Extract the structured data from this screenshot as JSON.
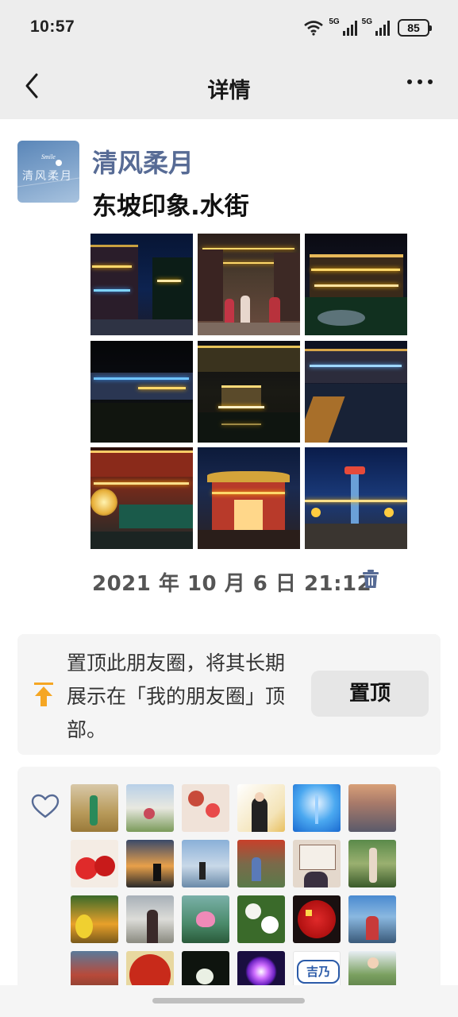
{
  "status_bar": {
    "time": "10:57",
    "network1": "5G",
    "network2": "5G",
    "battery": "85"
  },
  "nav": {
    "title": "详情"
  },
  "post": {
    "username": "清风柔月",
    "avatar_text": "清风柔月",
    "avatar_logo": "Smile",
    "text": "东坡印象.水街",
    "date": "2021 年 10 月 6 日 21:12",
    "photo_count": 9,
    "photo_icons": [
      "night-street-photo",
      "night-crowd-lanterns-photo",
      "night-pavilion-photo",
      "night-riverside-buildings-photo",
      "night-pavilion-reflection-photo",
      "night-bridge-water-photo",
      "night-lantern-gate-photo",
      "night-archway-photo",
      "night-tower-plaza-photo"
    ]
  },
  "pin_card": {
    "text": "置顶此朋友圈，将其长期展示在「我的朋友圈」顶部。",
    "button_label": "置顶"
  },
  "likes": {
    "liker_avatars": [
      "autumn-woman",
      "lake-woman",
      "cartoon-girl-chen",
      "graduation-woman",
      "blue-sky-tower",
      "sunset-sea",
      "red-cherries",
      "sunset-silhouette",
      "beach-woman",
      "garden-woman",
      "calligraphy-man",
      "flowers-woman",
      "yellow-fruit",
      "woman-temple",
      "pink-lotus",
      "white-flowers",
      "red-flag-coin",
      "seaside-woman",
      "temple-gate",
      "red-crest",
      "white-bud",
      "purple-firework",
      "jiyi-logo",
      "green-woman"
    ],
    "logo_text": "吉乃"
  },
  "colors": {
    "accent_name": "#576b95",
    "pin_icon": "#f5a623",
    "trash": "#576b95"
  }
}
